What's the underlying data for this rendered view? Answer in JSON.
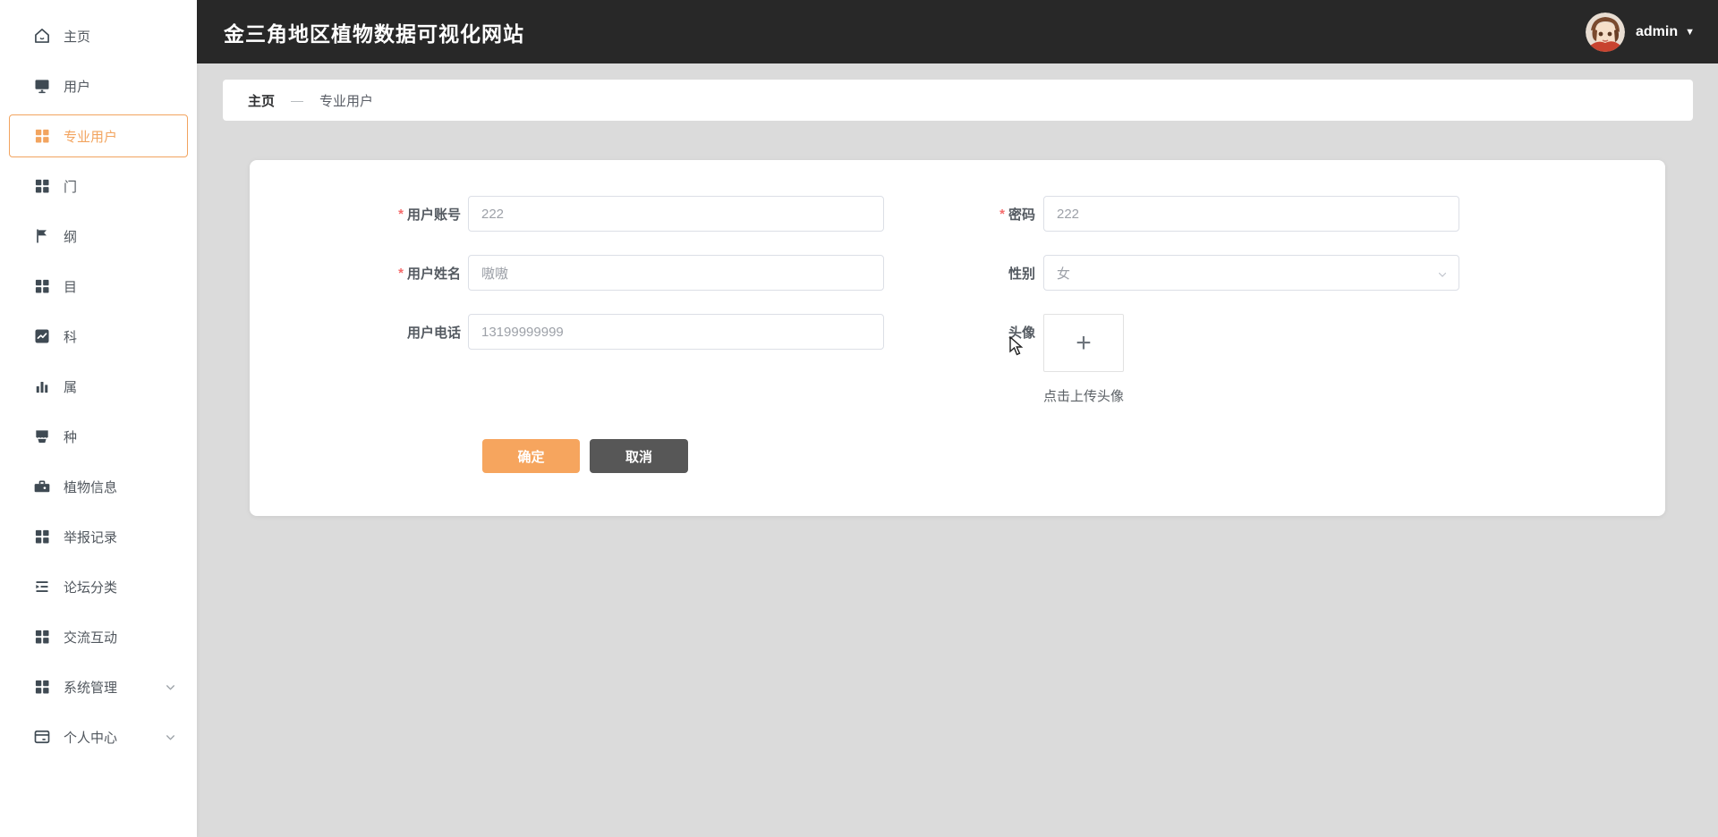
{
  "header": {
    "title": "金三角地区植物数据可视化网站",
    "user": "admin",
    "caret": "▼"
  },
  "breadcrumb": {
    "root": "主页",
    "separator": "—",
    "current": "专业用户"
  },
  "sidebar": {
    "items": [
      {
        "label": "主页",
        "icon": "home-icon",
        "active": false,
        "expandable": false
      },
      {
        "label": "用户",
        "icon": "monitor-icon",
        "active": false,
        "expandable": false
      },
      {
        "label": "专业用户",
        "icon": "grid-icon",
        "active": true,
        "expandable": false
      },
      {
        "label": "门",
        "icon": "grid-icon",
        "active": false,
        "expandable": false
      },
      {
        "label": "纲",
        "icon": "flag-icon",
        "active": false,
        "expandable": false
      },
      {
        "label": "目",
        "icon": "grid-icon",
        "active": false,
        "expandable": false
      },
      {
        "label": "科",
        "icon": "trend-chart-icon",
        "active": false,
        "expandable": false
      },
      {
        "label": "属",
        "icon": "bar-chart-icon",
        "active": false,
        "expandable": false
      },
      {
        "label": "种",
        "icon": "archive-icon",
        "active": false,
        "expandable": false
      },
      {
        "label": "植物信息",
        "icon": "briefcase-icon",
        "active": false,
        "expandable": false
      },
      {
        "label": "举报记录",
        "icon": "grid-icon",
        "active": false,
        "expandable": false
      },
      {
        "label": "论坛分类",
        "icon": "outdent-icon",
        "active": false,
        "expandable": false
      },
      {
        "label": "交流互动",
        "icon": "grid-icon",
        "active": false,
        "expandable": false
      },
      {
        "label": "系统管理",
        "icon": "grid-icon",
        "active": false,
        "expandable": true
      },
      {
        "label": "个人中心",
        "icon": "card-icon",
        "active": false,
        "expandable": true
      }
    ]
  },
  "form": {
    "account": {
      "label": "用户账号",
      "required": true,
      "value": "222"
    },
    "password": {
      "label": "密码",
      "required": true,
      "value": "222"
    },
    "name": {
      "label": "用户姓名",
      "required": true,
      "value": "嗷嗷"
    },
    "gender": {
      "label": "性别",
      "required": false,
      "value": "女"
    },
    "phone": {
      "label": "用户电话",
      "required": false,
      "value": "13199999999"
    },
    "avatar": {
      "label": "头像",
      "required": false,
      "plus": "+",
      "upload_hint": "点击上传头像"
    },
    "buttons": {
      "confirm": "确定",
      "cancel": "取消"
    }
  },
  "colors": {
    "accent_orange": "#f2a45f",
    "button_orange": "#f6a55e",
    "button_gray": "#575757",
    "header_bg": "#282828",
    "danger_red": "#f56c6c",
    "content_bg": "#dbdbdb"
  }
}
